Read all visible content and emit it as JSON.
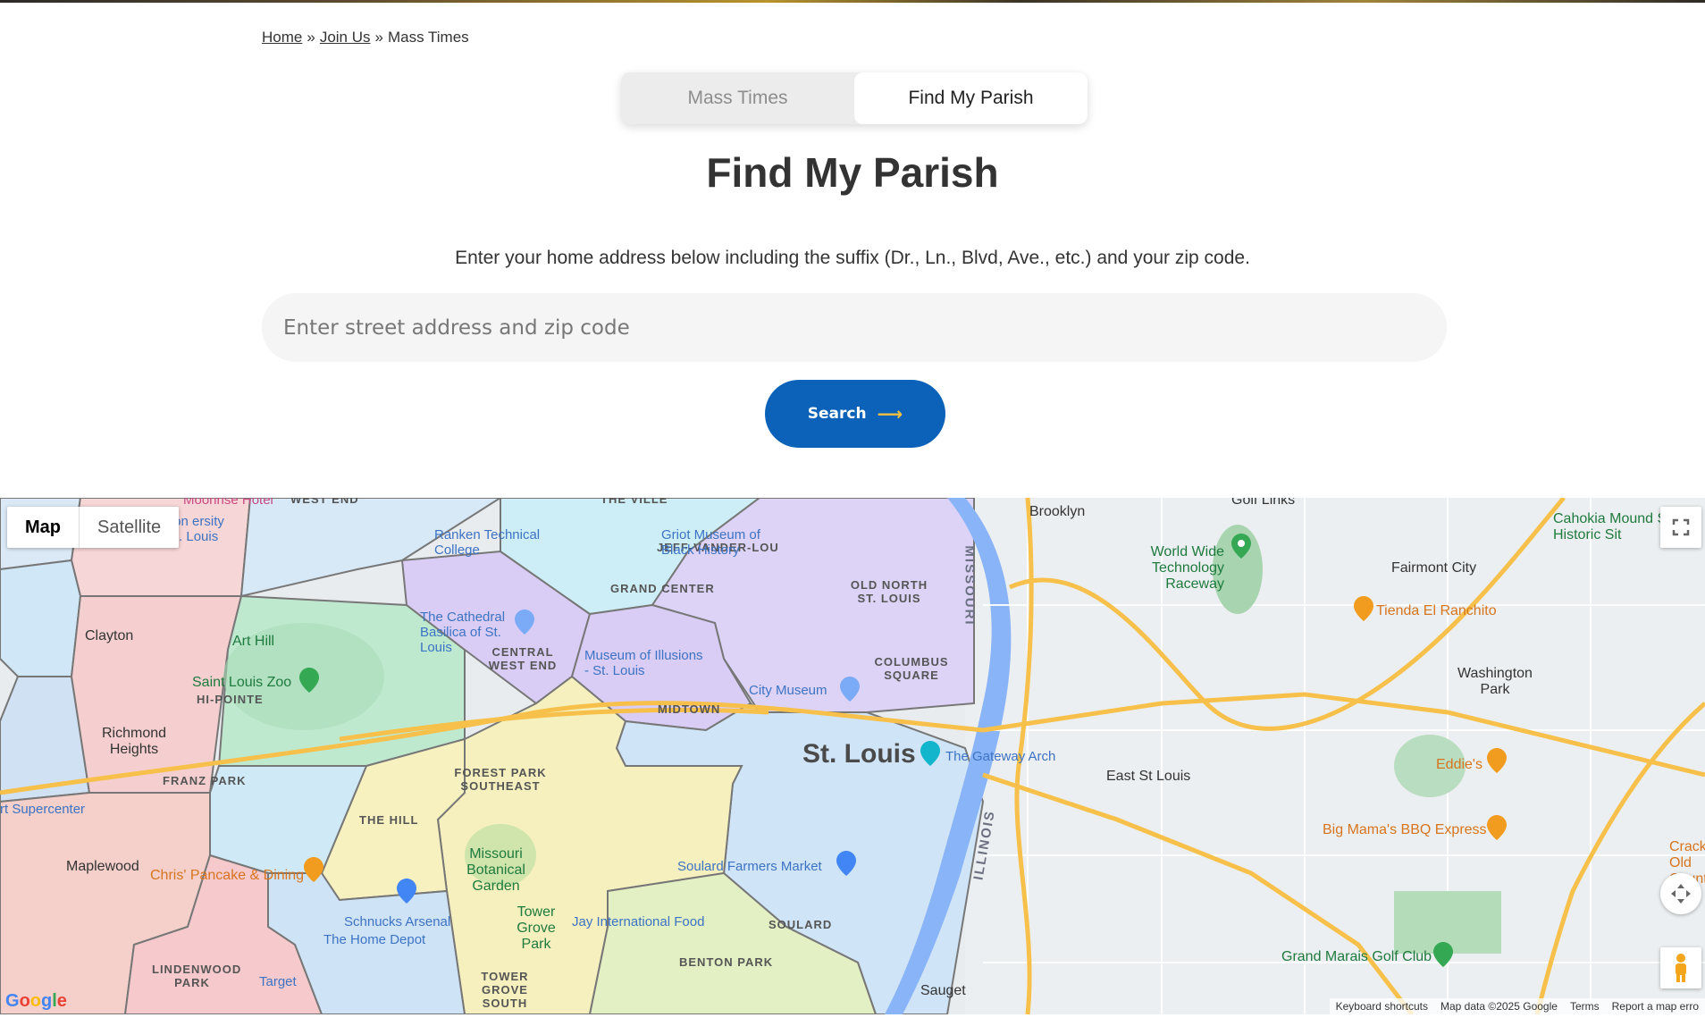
{
  "breadcrumb": {
    "home": "Home",
    "join_us": "Join Us",
    "current": "Mass Times",
    "separator": "»"
  },
  "tabs": [
    {
      "label": "Mass Times",
      "active": false
    },
    {
      "label": "Find My Parish",
      "active": true
    }
  ],
  "page_title": "Find My Parish",
  "instructions": "Enter your home address below including the suffix (Dr., Ln., Blvd, Ave., etc.) and your zip code.",
  "search": {
    "placeholder": "Enter street address and zip code",
    "button_label": "Search",
    "button_arrow": "⟶"
  },
  "map": {
    "type_controls": {
      "map": "Map",
      "satellite": "Satellite"
    },
    "labels": {
      "st_louis": "St. Louis",
      "east_st_louis": "East St Louis",
      "clayton": "Clayton",
      "richmond_heights": "Richmond Heights",
      "maplewood": "Maplewood",
      "fairmont_city": "Fairmont City",
      "washington_park": "Washington Park",
      "brooklyn": "Brooklyn",
      "sauget": "Sauget",
      "franz_park": "FRANZ PARK",
      "hi_pointe": "HI-POINTE",
      "the_hill": "THE HILL",
      "forest_park_southeast": "FOREST PARK SOUTHEAST",
      "central_west_end": "CENTRAL WEST END",
      "grand_center": "GRAND CENTER",
      "jeff_vander_lou": "JEFF-VANDER-LOU",
      "old_north_st_louis": "OLD NORTH ST. LOUIS",
      "columbus_square": "COLUMBUS SQUARE",
      "midtown": "MIDTOWN",
      "soulard": "SOULARD",
      "benton_park": "BENTON PARK",
      "tower_grove_south": "TOWER GROVE SOUTH",
      "lindenwood_park": "LINDENWOOD PARK",
      "the_ville": "THE VILLE",
      "west_end": "WEST END",
      "cathedral_basilica": "The Cathedral Basilica of St. Louis",
      "ranken": "Ranken Technical College",
      "griot_museum": "Griot Museum of Black History",
      "museum_of_illusions": "Museum of Illusions - St. Louis",
      "city_museum": "City Museum",
      "gateway_arch": "The Gateway Arch",
      "saint_louis_zoo": "Saint Louis Zoo",
      "art_hill": "Art Hill",
      "missouri_botanical": "Missouri Botanical Garden",
      "tower_grove_park": "Tower Grove Park",
      "soulard_farmers_market": "Soulard Farmers Market",
      "jay_international": "Jay International Food",
      "schnucks": "Schnucks Arsenal",
      "home_depot": "The Home Depot",
      "target": "Target",
      "chris_pancake": "Chris' Pancake & Dining",
      "art_supercenter": "rt Supercenter",
      "world_wide_tech": "World Wide Technology Raceway",
      "tienda": "Tienda El Ranchito",
      "eddies": "Eddie's",
      "big_mamas": "Big Mama's BBQ Express",
      "grand_marais": "Grand Marais Golf Club",
      "cahokia": "Cahokia Mound State Historic Sit",
      "crack_old_county": "Cracke Old Count",
      "moonrise": "Moonrise Hotel",
      "golf_links": "Golf Links",
      "washington_univ": "ington ersity in St. Louis",
      "river_missouri": "MISSOURI",
      "river_illinois": "ILLINOIS"
    },
    "footer": {
      "keyboard": "Keyboard shortcuts",
      "map_data": "Map data ©2025 Google",
      "terms": "Terms",
      "report": "Report a map erro"
    },
    "google_logo": "Google"
  },
  "colors": {
    "primary_button": "#0b62b8",
    "arrow_accent": "#f0c140",
    "text": "#333333",
    "input_bg": "#f5f5f5"
  }
}
